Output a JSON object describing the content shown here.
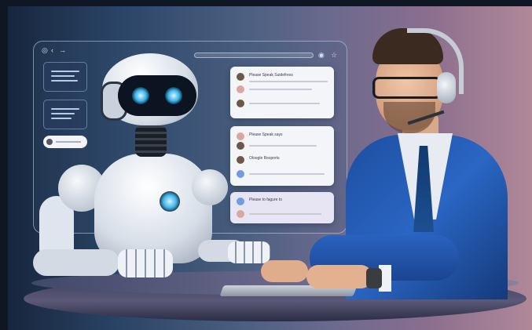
{
  "scene": {
    "description_colors": {
      "accent": "#3bb3e8",
      "suit": "#2a66c4",
      "card": "#f4f5f9"
    }
  },
  "window": {
    "icons": [
      "circle-icon",
      "chevron-left-icon",
      "arrow-right-icon",
      "record-icon",
      "star-icon"
    ]
  },
  "chat_cards": [
    {
      "rows": [
        {
          "label": "Please Speak Suidefress",
          "avatar": "man"
        },
        {
          "label": "",
          "avatar": "woman"
        },
        {
          "label": "",
          "avatar": "man"
        }
      ]
    },
    {
      "rows": [
        {
          "label": "Please Speak says",
          "avatar": "woman"
        },
        {
          "label": "",
          "avatar": "man"
        },
        {
          "label": "Oloogle Resports",
          "avatar": "man"
        },
        {
          "label": "",
          "avatar": "bot"
        }
      ]
    },
    {
      "rows": [
        {
          "label": "Please to fagure to",
          "avatar": "bot"
        },
        {
          "label": "",
          "avatar": "woman"
        }
      ]
    }
  ]
}
